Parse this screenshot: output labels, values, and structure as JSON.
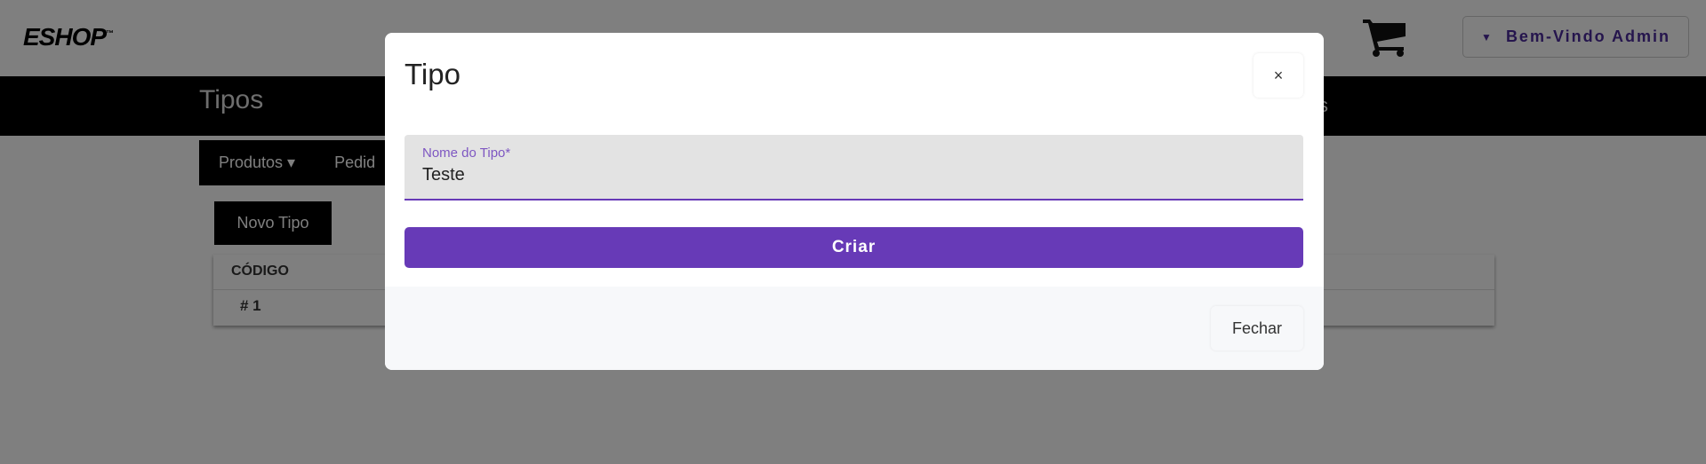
{
  "header": {
    "logo": "ESHOP",
    "logo_tm": "™",
    "cart_icon": "shopping-cart-icon",
    "user_menu_label": "Bem-Vindo Admin",
    "title": "Tipos",
    "right_partial": "s"
  },
  "nav": {
    "items": [
      {
        "label": "Produtos ▾"
      },
      {
        "label": "Pedid"
      }
    ]
  },
  "main": {
    "new_button": "Novo Tipo",
    "table": {
      "columns": [
        "CÓDIGO"
      ],
      "rows": [
        [
          "# 1"
        ]
      ]
    }
  },
  "modal": {
    "title": "Tipo",
    "close_label": "×",
    "field": {
      "label": "Nome do Tipo*",
      "value": "Teste"
    },
    "submit_label": "Criar",
    "footer_close_label": "Fechar"
  },
  "colors": {
    "accent": "#673ab7",
    "user_menu_text": "#4b2a9b"
  }
}
